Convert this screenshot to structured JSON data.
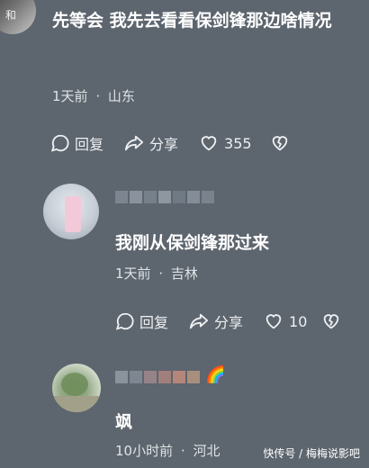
{
  "comment_main": {
    "text": "先等会 我先去看看保剑锋那边啥情况",
    "time": "1天前",
    "location": "山东",
    "reply_label": "回复",
    "share_label": "分享",
    "like_count": "355"
  },
  "reply_1": {
    "text": "我刚从保剑锋那过来",
    "time": "1天前",
    "location": "吉林",
    "reply_label": "回复",
    "share_label": "分享",
    "like_count": "10"
  },
  "reply_2": {
    "text": "飒",
    "time": "10小时前",
    "location": "河北",
    "name_emoji": "🌈"
  },
  "separator": "·",
  "watermark": "快传号 / 梅梅说影吧",
  "colors": {
    "background": "#5d656e",
    "text": "#ffffff",
    "meta": "#dfe3e6"
  },
  "icons": [
    "comment-icon",
    "share-icon",
    "heart-icon",
    "broken-heart-icon",
    "rainbow-icon"
  ]
}
